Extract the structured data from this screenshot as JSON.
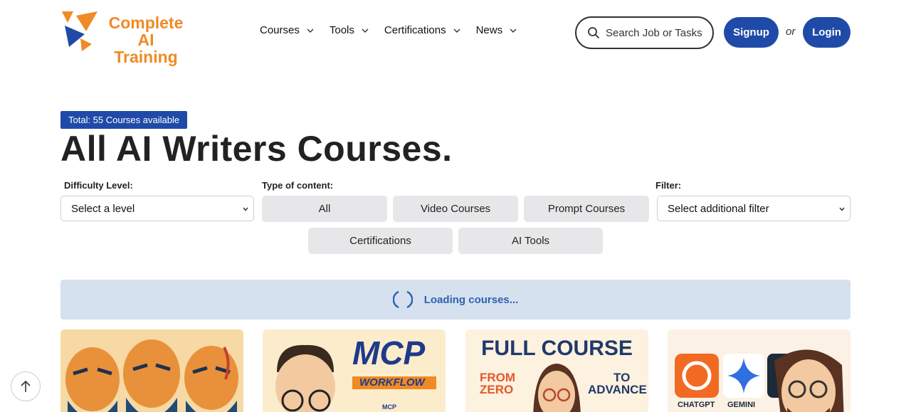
{
  "header": {
    "logo_line1": "Complete",
    "logo_line2": "AI Training",
    "nav": [
      {
        "label": "Courses"
      },
      {
        "label": "Tools"
      },
      {
        "label": "Certifications"
      },
      {
        "label": "News"
      }
    ],
    "search_placeholder": "Search Job or Tasks",
    "signup_label": "Signup",
    "or_label": "or",
    "login_label": "Login"
  },
  "main": {
    "total_badge": "Total: 55 Courses available",
    "title": "All AI Writers Courses.",
    "difficulty_label": "Difficulty Level:",
    "difficulty_value": "Select a level",
    "content_type_label": "Type of content:",
    "content_types": [
      "All",
      "Video Courses",
      "Prompt Courses",
      "Certifications",
      "AI Tools"
    ],
    "filter_label": "Filter:",
    "filter_value": "Select additional filter",
    "loading_text": "Loading courses..."
  },
  "cards": [
    {
      "title_lines": []
    },
    {
      "title_lines": [
        "MCP",
        "WORKFLOW",
        "MCP"
      ]
    },
    {
      "title_lines": [
        "FULL COURSE",
        "FROM",
        "ZERO",
        "TO",
        "ADVANCE"
      ]
    },
    {
      "title_lines": [
        "CHATGPT",
        "GEMINI"
      ]
    }
  ],
  "colors": {
    "brand_blue": "#1f4aa8",
    "logo_orange": "#f08a24",
    "loading_bg": "#d6e1ef",
    "segment_bg": "#e7e7e9"
  },
  "icons": {
    "search": "search-icon",
    "chevron": "chevron-down-icon",
    "scroll_top": "arrow-up-icon"
  }
}
